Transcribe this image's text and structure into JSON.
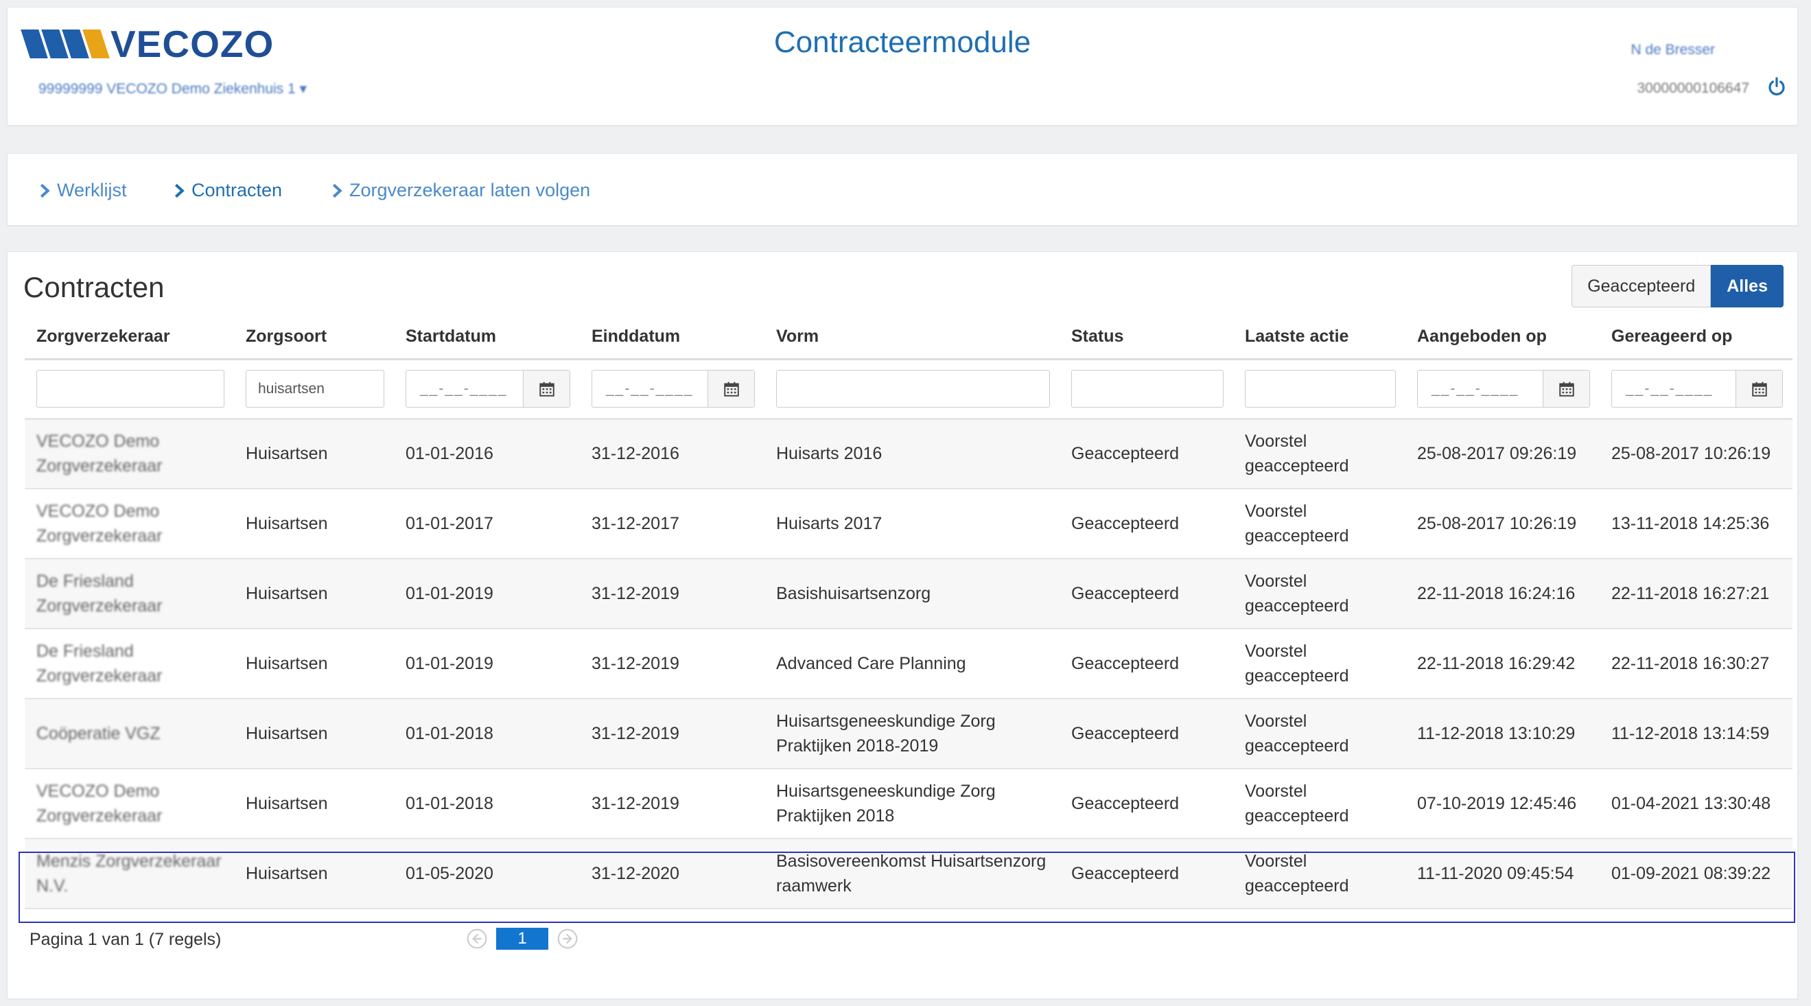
{
  "header": {
    "logo_text": "VECOZO",
    "app_title": "Contracteermodule",
    "org_selector": "99999999 VECOZO Demo Ziekenhuis 1 ▾",
    "user_name": "N de Bresser",
    "user_id": "30000000106647",
    "power_icon": "power-icon",
    "brand_colors": [
      "#1f5ea8",
      "#e8a317",
      "#1f4e96"
    ]
  },
  "nav": {
    "items": [
      {
        "label": "Werklijst"
      },
      {
        "label": "Contracten"
      },
      {
        "label": "Zorgverzekeraar laten volgen"
      }
    ],
    "chevron_icon": "chevron-right-icon"
  },
  "main": {
    "title": "Contracten",
    "toggle": {
      "accepted_label": "Geaccepteerd",
      "all_label": "Alles",
      "selected": "Alles"
    },
    "columns": [
      "Zorgverzekeraar",
      "Zorgsoort",
      "Startdatum",
      "Einddatum",
      "Vorm",
      "Status",
      "Laatste actie",
      "Aangeboden op",
      "Gereageerd op"
    ],
    "filters": {
      "zorgsoort_value": "huisartsen",
      "date_placeholder": "__-__-____",
      "calendar_icon": "calendar-icon"
    },
    "rows": [
      {
        "insurer": "VECOZO Demo Zorgverzekeraar",
        "care": "Huisartsen",
        "start": "01-01-2016",
        "end": "31-12-2016",
        "form": "Huisarts 2016",
        "status": "Geaccepteerd",
        "last_action": "Voorstel geaccepteerd",
        "offered": "25-08-2017 09:26:19",
        "responded": "25-08-2017 10:26:19"
      },
      {
        "insurer": "VECOZO Demo Zorgverzekeraar",
        "care": "Huisartsen",
        "start": "01-01-2017",
        "end": "31-12-2017",
        "form": "Huisarts 2017",
        "status": "Geaccepteerd",
        "last_action": "Voorstel geaccepteerd",
        "offered": "25-08-2017 10:26:19",
        "responded": "13-11-2018 14:25:36"
      },
      {
        "insurer": "De Friesland Zorgverzekeraar",
        "care": "Huisartsen",
        "start": "01-01-2019",
        "end": "31-12-2019",
        "form": "Basishuisartsenzorg",
        "status": "Geaccepteerd",
        "last_action": "Voorstel geaccepteerd",
        "offered": "22-11-2018 16:24:16",
        "responded": "22-11-2018 16:27:21"
      },
      {
        "insurer": "De Friesland Zorgverzekeraar",
        "care": "Huisartsen",
        "start": "01-01-2019",
        "end": "31-12-2019",
        "form": "Advanced Care Planning",
        "status": "Geaccepteerd",
        "last_action": "Voorstel geaccepteerd",
        "offered": "22-11-2018 16:29:42",
        "responded": "22-11-2018 16:30:27"
      },
      {
        "insurer": "Coöperatie VGZ",
        "care": "Huisartsen",
        "start": "01-01-2018",
        "end": "31-12-2019",
        "form": "Huisartsgeneeskundige Zorg Praktijken 2018-2019",
        "status": "Geaccepteerd",
        "last_action": "Voorstel geaccepteerd",
        "offered": "11-12-2018 13:10:29",
        "responded": "11-12-2018 13:14:59"
      },
      {
        "insurer": "VECOZO Demo Zorgverzekeraar",
        "care": "Huisartsen",
        "start": "01-01-2018",
        "end": "31-12-2019",
        "form": "Huisartsgeneeskundige Zorg Praktijken 2018",
        "status": "Geaccepteerd",
        "last_action": "Voorstel geaccepteerd",
        "offered": "07-10-2019 12:45:46",
        "responded": "01-04-2021 13:30:48"
      },
      {
        "insurer": "Menzis Zorgverzekeraar N.V.",
        "care": "Huisartsen",
        "start": "01-05-2020",
        "end": "31-12-2020",
        "form": "Basisovereenkomst Huisartsenzorg raamwerk",
        "status": "Geaccepteerd",
        "last_action": "Voorstel geaccepteerd",
        "offered": "11-11-2020 09:45:54",
        "responded": "01-09-2021 08:39:22"
      }
    ],
    "pager": {
      "text": "Pagina 1 van 1 (7 regels)",
      "current_page": "1",
      "prev_icon": "circle-arrow-left-icon",
      "next_icon": "circle-arrow-right-icon"
    }
  }
}
